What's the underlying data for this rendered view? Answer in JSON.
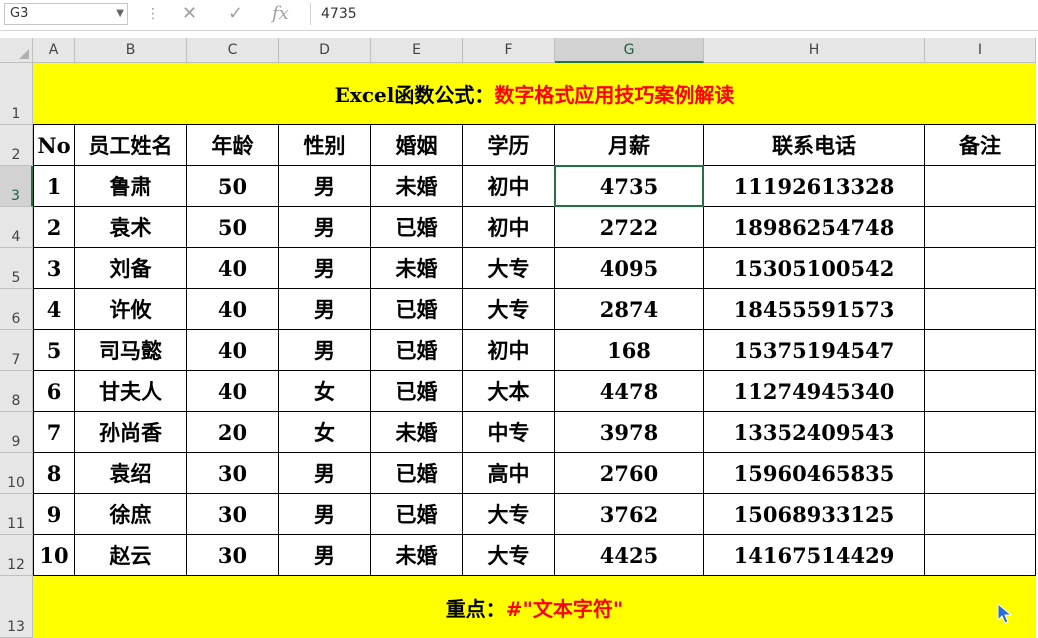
{
  "formula_bar": {
    "name_box": "G3",
    "cancel_icon": "✕",
    "enter_icon": "✓",
    "fx_icon": "fx",
    "value": "4735"
  },
  "sheet": {
    "columns": [
      "A",
      "B",
      "C",
      "D",
      "E",
      "F",
      "G",
      "H",
      "I"
    ],
    "rows": [
      "1",
      "2",
      "3",
      "4",
      "5",
      "6",
      "7",
      "8",
      "9",
      "10",
      "11",
      "12",
      "13"
    ],
    "selected_col": "G",
    "selected_row": "3",
    "title_black": "Excel函数公式：",
    "title_red": "数字格式应用技巧案例解读",
    "headers": [
      "No",
      "员工姓名",
      "年龄",
      "性别",
      "婚姻",
      "学历",
      "月薪",
      "联系电话",
      "备注"
    ],
    "data": [
      [
        "1",
        "鲁肃",
        "50",
        "男",
        "未婚",
        "初中",
        "4735",
        "11192613328",
        ""
      ],
      [
        "2",
        "袁术",
        "50",
        "男",
        "已婚",
        "初中",
        "2722",
        "18986254748",
        ""
      ],
      [
        "3",
        "刘备",
        "40",
        "男",
        "未婚",
        "大专",
        "4095",
        "15305100542",
        ""
      ],
      [
        "4",
        "许攸",
        "40",
        "男",
        "已婚",
        "大专",
        "2874",
        "18455591573",
        ""
      ],
      [
        "5",
        "司马懿",
        "40",
        "男",
        "已婚",
        "初中",
        "168",
        "15375194547",
        ""
      ],
      [
        "6",
        "甘夫人",
        "40",
        "女",
        "已婚",
        "大本",
        "4478",
        "11274945340",
        ""
      ],
      [
        "7",
        "孙尚香",
        "20",
        "女",
        "未婚",
        "中专",
        "3978",
        "13352409543",
        ""
      ],
      [
        "8",
        "袁绍",
        "30",
        "男",
        "已婚",
        "高中",
        "2760",
        "15960465835",
        ""
      ],
      [
        "9",
        "徐庶",
        "30",
        "男",
        "已婚",
        "大专",
        "3762",
        "15068933125",
        ""
      ],
      [
        "10",
        "赵云",
        "30",
        "男",
        "未婚",
        "大专",
        "4425",
        "14167514429",
        ""
      ]
    ],
    "footer_black": "重点：",
    "footer_red": "#\"文本字符\""
  },
  "colors": {
    "banner_yellow": "#ffff00",
    "accent_red": "#ff0000",
    "selection_green": "#217346"
  }
}
